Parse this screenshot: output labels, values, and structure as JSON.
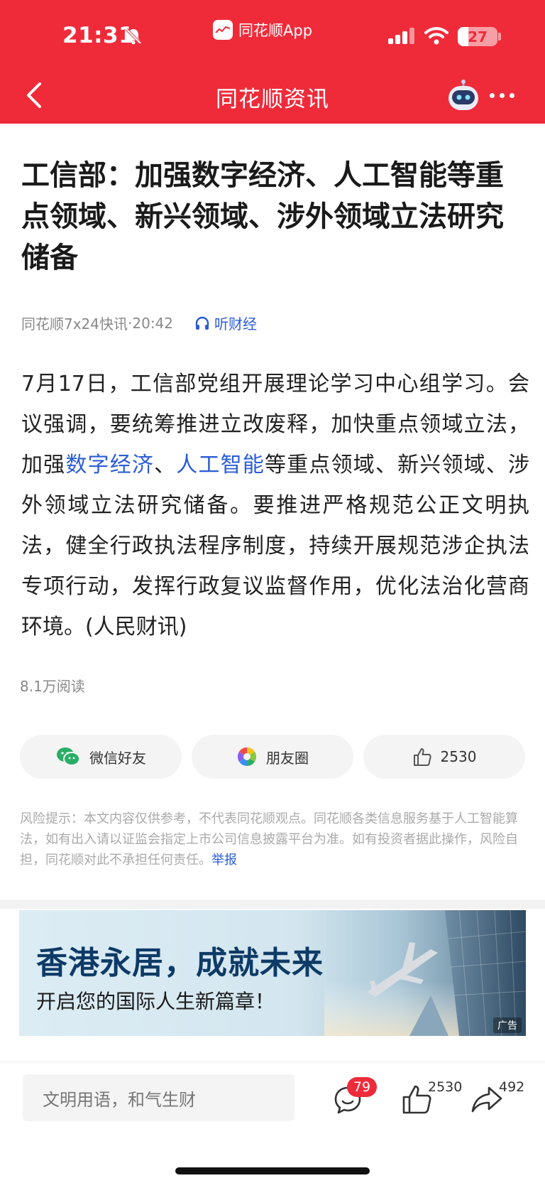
{
  "status_bar": {
    "time": "21:31",
    "app_name": "同花顺App",
    "battery": "27",
    "battery_level": 0.27
  },
  "nav": {
    "title": "同花顺资讯"
  },
  "article": {
    "title": "工信部：加强数字经济、人工智能等重点领域、新兴领域、涉外领域立法研究储备",
    "source": "同花顺7x24快讯",
    "separator": "·",
    "time": "20:42",
    "listen_label": "听财经",
    "body_1": "7月17日，工信部党组开展理论学习中心组学习。会议强调，要统筹推进立改废释，加快重点领域立法，加强",
    "link_1": "数字经济",
    "body_2": "、",
    "link_2": "人工智能",
    "body_3": "等重点领域、新兴领域、涉外领域立法研究储备。要推进严格规范公正文明执法，健全行政执法程序制度，持续开展规范涉企执法专项行动，发挥行政复议监督作用，优化法治化营商环境。(人民财讯)",
    "reads": "8.1万阅读"
  },
  "share": {
    "wechat_label": "微信好友",
    "moments_label": "朋友圈",
    "like_count": "2530"
  },
  "risk": {
    "text": "风险提示：本文内容仅供参考，不代表同花顺观点。同花顺各类信息服务基于人工智能算法，如有出入请以证监会指定上市公司信息披露平台为准。如有投资者据此操作，风险自担，同花顺对此不承担任何责任。",
    "report_label": "举报"
  },
  "ad": {
    "title": "香港永居，成就未来",
    "subtitle": "开启您的国际人生新篇章！",
    "tag": "广告"
  },
  "bottom_bar": {
    "comment_placeholder": "文明用语，和气生财",
    "comment_count": "79",
    "like_count": "2530",
    "share_count": "492"
  },
  "colors": {
    "brand_red": "#ef2b3a",
    "link_blue": "#2b5cd8"
  },
  "icons": [
    "back-arrow-icon",
    "bell-muted-icon",
    "signal-icon",
    "wifi-icon",
    "battery-icon",
    "robot-icon",
    "more-dots-icon",
    "headphones-icon",
    "wechat-icon",
    "moments-icon",
    "thumbs-up-icon",
    "comment-icon",
    "share-icon"
  ]
}
